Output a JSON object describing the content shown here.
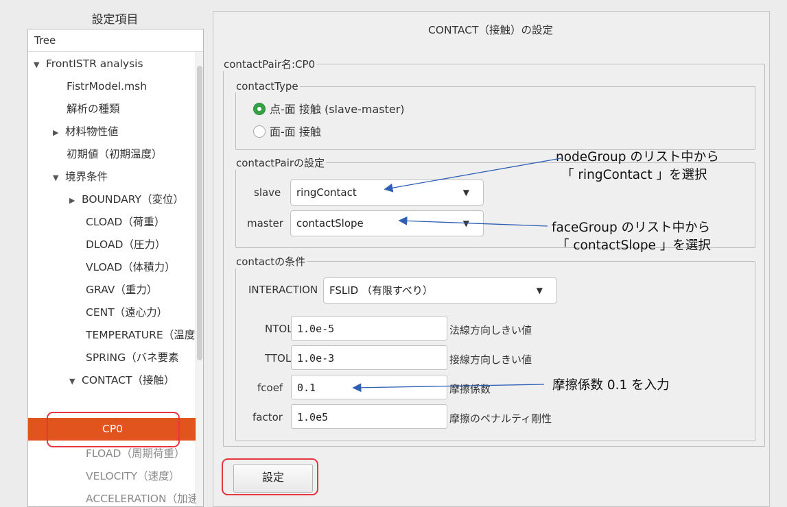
{
  "left_panel": {
    "title": "設定項目",
    "tree_header": "Tree",
    "items": [
      {
        "label": "FrontISTR analysis",
        "arrow": "▼"
      },
      {
        "label": "FistrModel.msh",
        "arrow": ""
      },
      {
        "label": "解析の種類",
        "arrow": ""
      },
      {
        "label": "材料物性値",
        "arrow": "▶"
      },
      {
        "label": "初期値（初期温度）",
        "arrow": ""
      },
      {
        "label": "境界条件",
        "arrow": "▼"
      },
      {
        "label": "BOUNDARY（変位）",
        "arrow": "▶"
      },
      {
        "label": "CLOAD（荷重）",
        "arrow": ""
      },
      {
        "label": "DLOAD（圧力）",
        "arrow": ""
      },
      {
        "label": "VLOAD（体積力）",
        "arrow": ""
      },
      {
        "label": "GRAV（重力）",
        "arrow": ""
      },
      {
        "label": "CENT（遠心力）",
        "arrow": ""
      },
      {
        "label": "TEMPERATURE（温度",
        "arrow": ""
      },
      {
        "label": "SPRING（バネ要素",
        "arrow": ""
      },
      {
        "label": "CONTACT（接触）",
        "arrow": "▼"
      },
      {
        "label": "CP0",
        "arrow": "",
        "selected": true
      },
      {
        "label": "FLOAD（周期荷重）",
        "arrow": ""
      },
      {
        "label": "VELOCITY（速度）",
        "arrow": ""
      },
      {
        "label": "ACCELERATION（加速",
        "arrow": ""
      }
    ]
  },
  "right_panel": {
    "title": "CONTACT（接触）の設定",
    "pair_group_legend": "contactPair名:CP0",
    "contact_type": {
      "legend": "contactType",
      "options": [
        {
          "label": "点-面 接触 (slave-master)",
          "selected": true
        },
        {
          "label": "面-面 接触",
          "selected": false
        }
      ]
    },
    "pair_settings": {
      "legend": "contactPairの設定",
      "slave_label": "slave",
      "slave_value": "ringContact",
      "master_label": "master",
      "master_value": "contactSlope"
    },
    "conditions": {
      "legend": "contactの条件",
      "interaction_label": "INTERACTION",
      "interaction_value": "FSLID （有限すべり）",
      "fields": [
        {
          "label": "NTOL",
          "value": "1.0e-5",
          "desc": "法線方向しきい値"
        },
        {
          "label": "TTOL",
          "value": "1.0e-3",
          "desc": "接線方向しきい値"
        },
        {
          "label": "fcoef",
          "value": "0.1",
          "desc": "摩擦係数"
        },
        {
          "label": "factor",
          "value": "1.0e5",
          "desc": "摩擦のペナルティ剛性"
        }
      ]
    },
    "set_button": "設定"
  },
  "annotations": {
    "slave_line1": "nodeGroup のリスト中から",
    "slave_line2": "「 ringContact 」を選択",
    "master_line1": "faceGroup のリスト中から",
    "master_line2": "「 contactSlope 」を選択",
    "fcoef": "摩擦係数 0.1 を入力"
  },
  "colors": {
    "selected_bg": "#e2541e",
    "radio_on": "#35a046",
    "arrow": "#2f5fb5",
    "highlight_box": "#e8353e"
  }
}
